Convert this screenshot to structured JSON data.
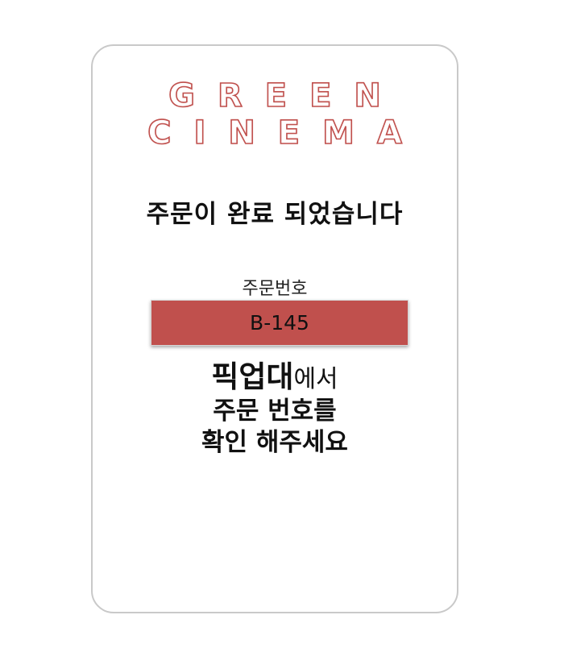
{
  "logo": {
    "line1": "GREEN",
    "line2": "CINEMA",
    "brand_color": "#c0504d"
  },
  "headline": "주문이 완료 되었습니다",
  "order": {
    "label": "주문번호",
    "number": "B-145",
    "box_color": "#c0504d"
  },
  "instructions": {
    "line1_bold": "픽업대",
    "line1_light": "에서",
    "line2": "주문 번호를",
    "line3": "확인 해주세요"
  }
}
